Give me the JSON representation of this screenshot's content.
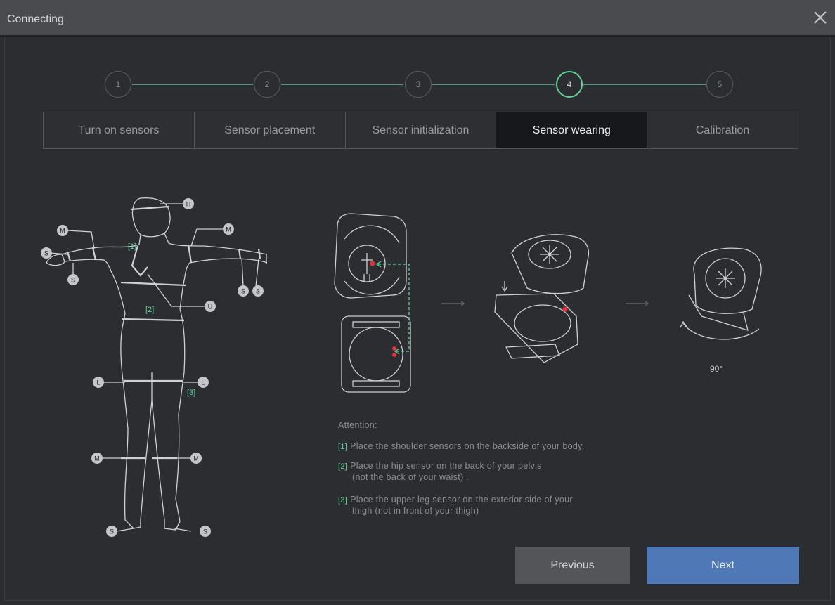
{
  "window": {
    "title": "Connecting"
  },
  "steps": [
    "1",
    "2",
    "3",
    "4",
    "5"
  ],
  "active_step": 4,
  "tabs": [
    {
      "label": "Turn on sensors"
    },
    {
      "label": "Sensor placement"
    },
    {
      "label": "Sensor initialization"
    },
    {
      "label": "Sensor wearing"
    },
    {
      "label": "Calibration"
    }
  ],
  "body_labels": {
    "head": "H",
    "upper_arm_left": "M",
    "upper_arm_right": "M",
    "hand_left": "S",
    "wrist_left": "S",
    "hand_right_a": "S",
    "hand_right_b": "S",
    "hip": "U",
    "thigh_left": "L",
    "thigh_right": "L",
    "calf_left": "M",
    "calf_right": "M",
    "foot_left": "S",
    "foot_right": "S"
  },
  "body_markers": {
    "shoulder": "[1]",
    "hip": "[2]",
    "thigh": "[3]"
  },
  "rotation_label": "90°",
  "attention": {
    "heading": "Attention:",
    "notes": [
      {
        "num": "[1]",
        "line1": "Place the shoulder sensors on the backside of your body.",
        "line2": ""
      },
      {
        "num": "[2]",
        "line1": "Place the hip sensor on the back of your pelvis",
        "line2": "(not the back of your waist) ."
      },
      {
        "num": "[3]",
        "line1": "Place the upper leg sensor on the exterior side of your",
        "line2": "thigh (not in front of your thigh)"
      }
    ]
  },
  "buttons": {
    "previous": "Previous",
    "next": "Next"
  },
  "colors": {
    "accent": "#5fd39a",
    "next_button": "#4f78b7",
    "marker_red": "#e0333a"
  }
}
